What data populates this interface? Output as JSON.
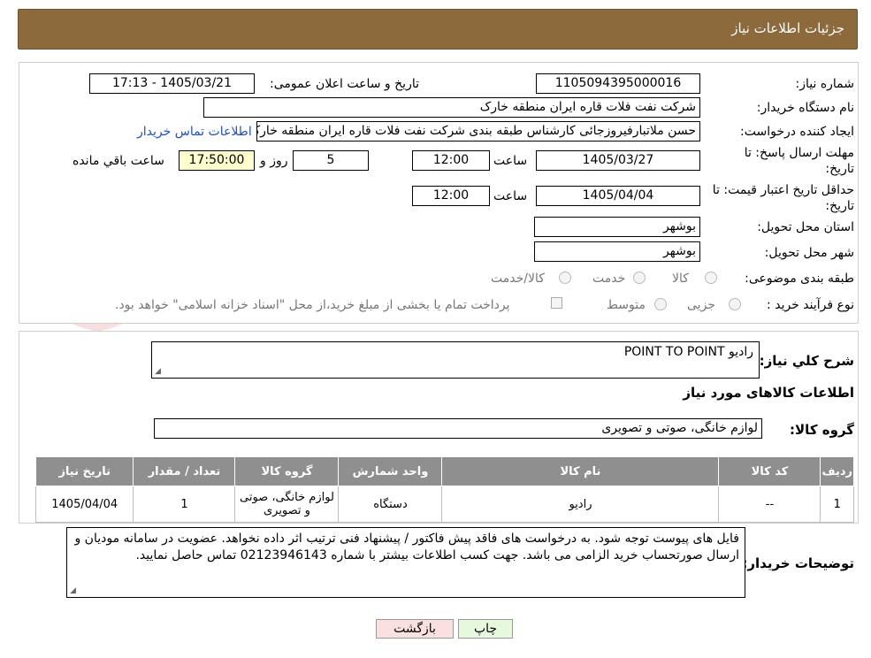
{
  "header": {
    "title": "جزئیات اطلاعات نیاز"
  },
  "form": {
    "need_number_label": "شماره نیاز:",
    "need_number": "1105094395000016",
    "announce_label": "تاریخ و ساعت اعلان عمومی:",
    "announce_value": "1405/03/21 - 17:13",
    "buyer_org_label": "نام دستگاه خریدار:",
    "buyer_org": "شرکت نفت فلات قاره ایران منطقه خارک",
    "creator_label": "ایجاد کننده درخواست:",
    "creator": "حسن ملاتبارفیروزجائی کارشناس طبقه بندی  شرکت نفت فلات قاره ایران منطقه خارک",
    "contact_link": "اطلاعات تماس خریدار",
    "deadline_label": "مهلت ارسال پاسخ: تا تاریخ:",
    "deadline_date": "1405/03/27",
    "time_label": "ساعت",
    "deadline_time": "12:00",
    "days_value": "5",
    "days_label": "روز و",
    "remaining_time": "17:50:00",
    "remaining_label": "ساعت باقي مانده",
    "validity_label": "حداقل تاریخ اعتبار قیمت: تا تاریخ:",
    "validity_date": "1405/04/04",
    "validity_time": "12:00",
    "province_label": "استان محل تحویل:",
    "province": "بوشهر",
    "city_label": "شهر محل تحویل:",
    "city": "بوشهر",
    "category_label": "طبقه بندی موضوعی:",
    "category_options": [
      "کالا",
      "خدمت",
      "کالا/خدمت"
    ],
    "process_label": "نوع فرآیند خرید :",
    "process_options": [
      "جزیی",
      "متوسط"
    ],
    "payment_note": "پرداخت تمام یا بخشی از مبلغ خرید،از محل \"اسناد خزانه اسلامی\" خواهد بود."
  },
  "watermark": {
    "text": "AriaTender.neT"
  },
  "summary": {
    "desc_label": "شرح کلي نياز:",
    "desc_value": "رادیو POINT TO POINT",
    "items_heading": "اطلاعات کالاهای مورد نياز",
    "group_label": "گروه کالا:",
    "group_value": "لوازم خانگی، صوتی و تصویری"
  },
  "table": {
    "headers": [
      "ردیف",
      "کد کالا",
      "نام کالا",
      "واحد شمارش",
      "گروه کالا",
      "تعداد / مقدار",
      "تاریخ نیاز"
    ],
    "rows": [
      {
        "row": "1",
        "code": "--",
        "name": "رادیو",
        "unit": "دستگاه",
        "group": "لوازم خانگی، صوتی و تصویری",
        "qty": "1",
        "date": "1405/04/04"
      }
    ]
  },
  "notes": {
    "label": "توضیحات خریدار:",
    "text": "فایل های پیوست توجه شود. به درخواست های فاقد پیش فاکتور / پیشنهاد فنی ترتیب اثر داده نخواهد. عضویت در سامانه مودیان و ارسال صورتحساب خرید الزامی می باشد. جهت کسب اطلاعات بیشتر با شماره 02123946143 تماس حاصل نمایید."
  },
  "buttons": {
    "print": "چاپ",
    "back": "بازگشت"
  },
  "colors": {
    "header_bg": "#8c6a3c",
    "table_header": "#8f8f8f",
    "print_btn": "#e6f9df",
    "back_btn": "#fbe0e0",
    "remaining_bg": "#ffffcc"
  }
}
